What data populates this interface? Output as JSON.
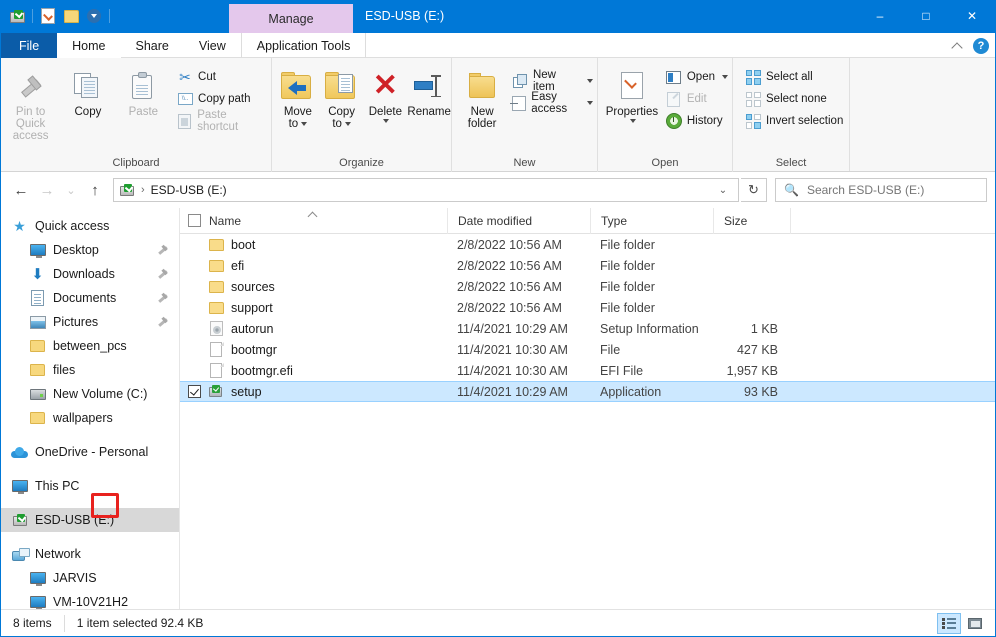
{
  "window": {
    "title": "ESD-USB (E:)",
    "contextual_tab": "Manage",
    "minimize": "–",
    "maximize": "□",
    "close": "✕",
    "quick_access": [
      {
        "name": "usb-drive-icon",
        "label": "ESD-USB (E:)"
      },
      {
        "name": "properties-icon",
        "label": "Properties"
      },
      {
        "name": "new-folder-icon",
        "label": "New folder"
      },
      {
        "name": "customize-caret-icon",
        "label": "Customize Quick Access Toolbar"
      }
    ]
  },
  "tabs": [
    {
      "label": "File",
      "type": "file"
    },
    {
      "label": "Home",
      "type": "active"
    },
    {
      "label": "Share",
      "type": "normal"
    },
    {
      "label": "View",
      "type": "normal"
    },
    {
      "label": "Application Tools",
      "type": "contextual"
    }
  ],
  "ribbon_right": {
    "collapse_label": "Collapse the Ribbon",
    "help_label": "?"
  },
  "ribbon": {
    "groups": [
      {
        "name": "Clipboard",
        "big_buttons": [
          {
            "label_line1": "Pin to Quick",
            "label_line2": "access",
            "disabled": true
          },
          {
            "label_line1": "Copy",
            "label_line2": "",
            "disabled": false
          },
          {
            "label_line1": "Paste",
            "label_line2": "",
            "disabled": true
          }
        ],
        "small_buttons": [
          {
            "label": "Cut",
            "disabled": false
          },
          {
            "label": "Copy path",
            "disabled": false
          },
          {
            "label": "Paste shortcut",
            "disabled": true
          }
        ]
      },
      {
        "name": "Organize",
        "big_buttons": [
          {
            "label_line1": "Move",
            "label_line2": "to",
            "has_caret": true
          },
          {
            "label_line1": "Copy",
            "label_line2": "to",
            "has_caret": true
          },
          {
            "label_line1": "Delete",
            "label_line2": "",
            "has_caret": true
          },
          {
            "label_line1": "Rename",
            "label_line2": "",
            "has_caret": false
          }
        ]
      },
      {
        "name": "New",
        "big_buttons": [
          {
            "label_line1": "New",
            "label_line2": "folder"
          }
        ],
        "small_buttons": [
          {
            "label": "New item",
            "has_caret": true
          },
          {
            "label": "Easy access",
            "has_caret": true
          }
        ]
      },
      {
        "name": "Open",
        "big_buttons": [
          {
            "label_line1": "Properties",
            "label_line2": "",
            "has_caret": true
          }
        ],
        "small_buttons": [
          {
            "label": "Open",
            "has_caret": true,
            "disabled": false
          },
          {
            "label": "Edit",
            "disabled": true
          },
          {
            "label": "History",
            "disabled": false
          }
        ]
      },
      {
        "name": "Select",
        "small_buttons": [
          {
            "label": "Select all"
          },
          {
            "label": "Select none"
          },
          {
            "label": "Invert selection"
          }
        ]
      }
    ]
  },
  "address_bar": {
    "back": "←",
    "forward": "→",
    "recent": "⌄",
    "up": "↑",
    "drive_icon_name": "usb-drive-icon",
    "crumb": "ESD-USB (E:)",
    "separator": "›",
    "dropdown": "⌄",
    "refresh": "↻",
    "search_placeholder": "Search ESD-USB (E:)",
    "search_value": ""
  },
  "nav_pane": {
    "items": [
      {
        "label": "Quick access",
        "icon": "star-icon",
        "level": 0,
        "pinned": false,
        "selected": false
      },
      {
        "label": "Desktop",
        "icon": "desktop-icon",
        "level": 1,
        "pinned": true,
        "selected": false
      },
      {
        "label": "Downloads",
        "icon": "download-icon",
        "level": 1,
        "pinned": true,
        "selected": false
      },
      {
        "label": "Documents",
        "icon": "documents-icon",
        "level": 1,
        "pinned": true,
        "selected": false
      },
      {
        "label": "Pictures",
        "icon": "pictures-icon",
        "level": 1,
        "pinned": true,
        "selected": false
      },
      {
        "label": "between_pcs",
        "icon": "folder-icon",
        "level": 1,
        "pinned": false,
        "selected": false
      },
      {
        "label": "files",
        "icon": "folder-icon",
        "level": 1,
        "pinned": false,
        "selected": false
      },
      {
        "label": "New Volume (C:)",
        "icon": "drive-icon",
        "level": 1,
        "pinned": false,
        "selected": false
      },
      {
        "label": "wallpapers",
        "icon": "folder-icon",
        "level": 1,
        "pinned": false,
        "selected": false
      },
      {
        "label": "OneDrive - Personal",
        "icon": "cloud-icon",
        "level": 0,
        "pinned": false,
        "selected": false,
        "gap_before": true
      },
      {
        "label": "This PC",
        "icon": "desktop-icon",
        "level": 0,
        "pinned": false,
        "selected": false,
        "gap_before": true
      },
      {
        "label": "ESD-USB (E:)",
        "icon": "usb-drive-icon",
        "level": 0,
        "pinned": false,
        "selected": true,
        "gap_before": true
      },
      {
        "label": "Network",
        "icon": "network-icon",
        "level": 0,
        "pinned": false,
        "selected": false,
        "gap_before": true
      },
      {
        "label": "JARVIS",
        "icon": "desktop-icon",
        "level": 1,
        "pinned": false,
        "selected": false
      },
      {
        "label": "VM-10V21H2",
        "icon": "desktop-icon",
        "level": 1,
        "pinned": false,
        "selected": false
      }
    ]
  },
  "file_list": {
    "columns": [
      {
        "label": "Name",
        "sorted": true
      },
      {
        "label": "Date modified",
        "sorted": false
      },
      {
        "label": "Type",
        "sorted": false
      },
      {
        "label": "Size",
        "sorted": false
      }
    ],
    "rows": [
      {
        "name": "boot",
        "date": "2/8/2022 10:56 AM",
        "type": "File folder",
        "size": "",
        "icon": "folder-icon",
        "checked": false,
        "selected": false
      },
      {
        "name": "efi",
        "date": "2/8/2022 10:56 AM",
        "type": "File folder",
        "size": "",
        "icon": "folder-icon",
        "checked": false,
        "selected": false
      },
      {
        "name": "sources",
        "date": "2/8/2022 10:56 AM",
        "type": "File folder",
        "size": "",
        "icon": "folder-icon",
        "checked": false,
        "selected": false
      },
      {
        "name": "support",
        "date": "2/8/2022 10:56 AM",
        "type": "File folder",
        "size": "",
        "icon": "folder-icon",
        "checked": false,
        "selected": false
      },
      {
        "name": "autorun",
        "date": "11/4/2021 10:29 AM",
        "type": "Setup Information",
        "size": "1 KB",
        "icon": "setup-information-icon",
        "checked": false,
        "selected": false
      },
      {
        "name": "bootmgr",
        "date": "11/4/2021 10:30 AM",
        "type": "File",
        "size": "427 KB",
        "icon": "file-icon",
        "checked": false,
        "selected": false
      },
      {
        "name": "bootmgr.efi",
        "date": "11/4/2021 10:30 AM",
        "type": "EFI File",
        "size": "1,957 KB",
        "icon": "file-icon",
        "checked": false,
        "selected": false
      },
      {
        "name": "setup",
        "date": "11/4/2021 10:29 AM",
        "type": "Application",
        "size": "93 KB",
        "icon": "application-icon",
        "checked": true,
        "selected": true
      }
    ]
  },
  "status_bar": {
    "item_count": "8 items",
    "selection_info": "1 item selected  92.4 KB",
    "view_details_label": "Details view",
    "view_large_label": "Large icons view"
  },
  "annotation": {
    "label": "drive-letter-highlight",
    "color": "#e8221e"
  }
}
